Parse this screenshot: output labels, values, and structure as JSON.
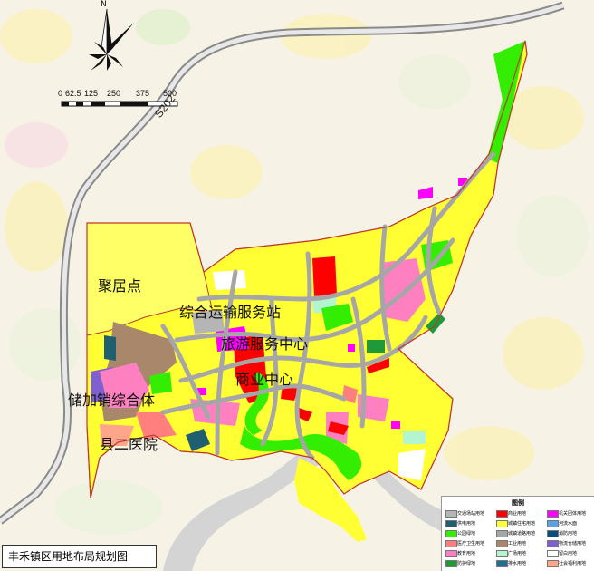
{
  "map_title": "丰禾镇区用地布局规划图",
  "road_label": "S202",
  "north_label": "N",
  "scale_ticks": [
    "0",
    "62.5",
    "125",
    "250",
    "375",
    "500"
  ],
  "labels": {
    "juju": "聚居点",
    "zonghe": "综合运输服务站",
    "lvyou": "旅游服务中心",
    "shangye": "商业中心",
    "chujia": "储加销综合体",
    "yiyuan": "县二医院"
  },
  "legend": {
    "title": "图例",
    "items": [
      {
        "name": "交通场站用地",
        "color": "#b5b5b5"
      },
      {
        "name": "商业用地",
        "color": "#ff0000"
      },
      {
        "name": "机关团体用地",
        "color": "#ff00ff"
      },
      {
        "name": "供电用地",
        "color": "#1f5f6f"
      },
      {
        "name": "城镇住宅用地",
        "color": "#ffff33"
      },
      {
        "name": "河流水面",
        "color": "#5aa0e6"
      },
      {
        "name": "公园绿地",
        "color": "#33ee00"
      },
      {
        "name": "城镇道路用地",
        "color": "#a6a6a6"
      },
      {
        "name": "消防用地",
        "color": "#0b4d7a"
      },
      {
        "name": "医疗卫生用地",
        "color": "#ff7f7f"
      },
      {
        "name": "工业用地",
        "color": "#a9876a"
      },
      {
        "name": "物流仓储用地",
        "color": "#8060cc"
      },
      {
        "name": "教育用地",
        "color": "#ff80c0"
      },
      {
        "name": "广场用地",
        "color": "#b3f5d0"
      },
      {
        "name": "留白用地",
        "color": "#ffffff"
      },
      {
        "name": "防护绿地",
        "color": "#1f9a3a"
      },
      {
        "name": "排水用地",
        "color": "#1f6f8f"
      },
      {
        "name": "社会福利用地",
        "color": "#ffa58a"
      }
    ]
  },
  "colors": {
    "background": "#f6f3e6",
    "residential": "#ffff33",
    "road": "#a6a6a6",
    "river": "#d4d4d4",
    "boundary": "#c0392b"
  }
}
